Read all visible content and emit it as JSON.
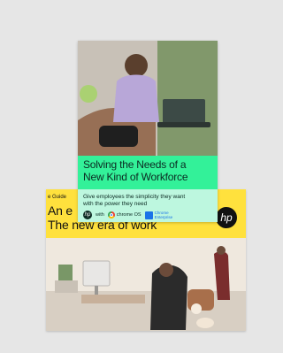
{
  "front_cover": {
    "headline_line1": "Solving the Needs of a",
    "headline_line2": "New Kind of Workforce",
    "subheadline_line1": "Give employees the simplicity they want",
    "subheadline_line2": "with the power they need",
    "logos": {
      "hp_mark": "hp",
      "with_text": "with",
      "chrome_os": "chrome OS",
      "enterprise_text": "Chrome Enterprise"
    },
    "colors": {
      "headline_bg": "#33f199",
      "subheadline_bg": "#bdf7df"
    }
  },
  "back_cover": {
    "label": "e Guide",
    "title_line1": "An e",
    "title_line2": "The new era of work",
    "logo": "hp",
    "colors": {
      "band": "#ffe13d"
    }
  }
}
